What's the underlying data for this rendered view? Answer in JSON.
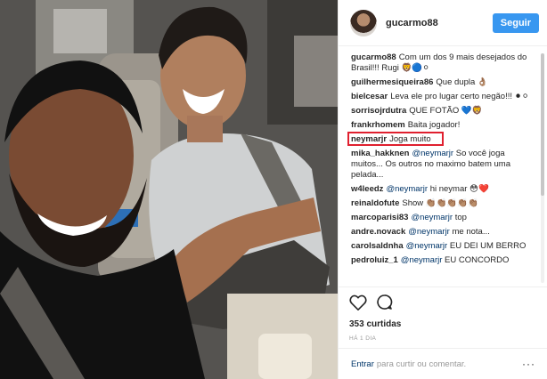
{
  "header": {
    "username": "gucarmo88",
    "follow_label": "Seguir"
  },
  "comments": [
    {
      "user": "gucarmo88",
      "text": "Com um dos 9 mais desejados do Brasil!!! Rugi 🦁🔵⚪"
    },
    {
      "user": "guilhermesiqueira86",
      "text": "Que dupla 👌🏽"
    },
    {
      "user": "bielcesar",
      "text": "Leva ele pro lugar certo negão!!! ⚫⚪"
    },
    {
      "user": "sorrisojrdutra",
      "text": "QUE FOTÃO 💙🦁"
    },
    {
      "user": "frankrhomem",
      "text": "Baita jogador!"
    },
    {
      "user": "neymarjr",
      "text": "Joga muito"
    },
    {
      "user": "mika_hakknen",
      "mention": "@neymarjr",
      "text": "So você joga muitos... Os outros no maximo batem uma pelada..."
    },
    {
      "user": "w4leedz",
      "mention": "@neymarjr",
      "text": "hi neymar 😳❤️"
    },
    {
      "user": "reinaldofute",
      "text": "Show 👏🏽👏🏽👏🏽👏🏽👏🏽"
    },
    {
      "user": "marcoparisi83",
      "mention": "@neymarjr",
      "text": "top"
    },
    {
      "user": "andre.novack",
      "mention": "@neymarjr",
      "text": "me nota..."
    },
    {
      "user": "carolsaldnha",
      "mention": "@neymarjr",
      "text": "EU DEI UM BERRO"
    },
    {
      "user": "pedroluiz_1",
      "mention": "@neymarjr",
      "text": "EU CONCORDO"
    }
  ],
  "actions": {
    "likes": "353 curtidas",
    "time": "HÁ 1 DIA"
  },
  "add_comment": {
    "login_label": "Entrar",
    "text": "para curtir ou comentar.",
    "more": "···"
  },
  "colors": {
    "follow": "#3897f0",
    "highlight": "#e0202f",
    "link": "#003569"
  }
}
